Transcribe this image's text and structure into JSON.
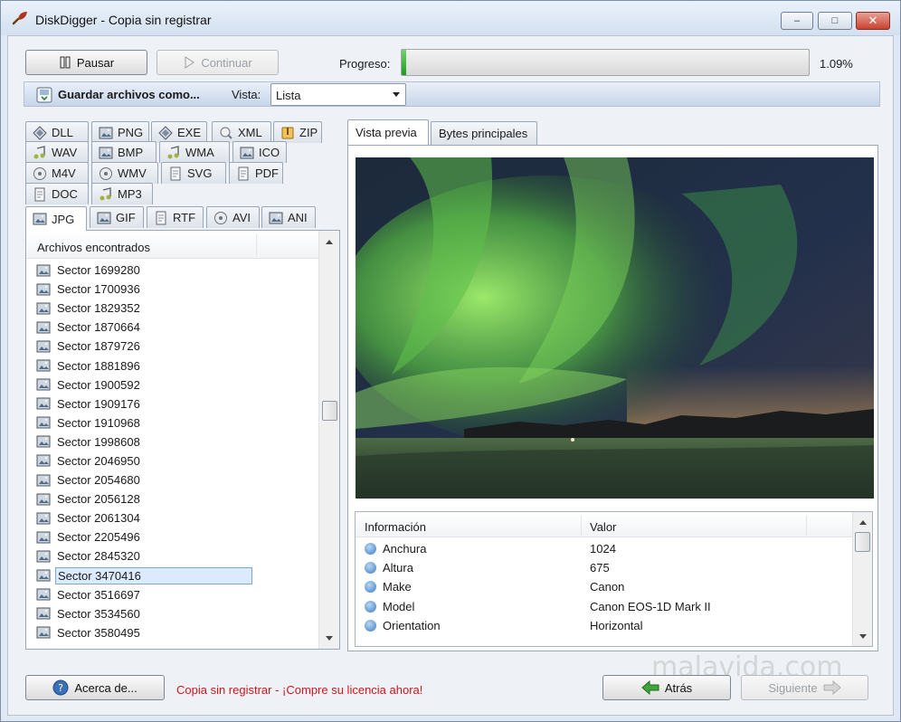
{
  "window": {
    "title": "DiskDigger - Copia sin registrar",
    "minimize_glyph": "–",
    "maximize_glyph": "□",
    "close_glyph": "✕"
  },
  "toolbar": {
    "pause_label": "Pausar",
    "continue_label": "Continuar",
    "progress_label": "Progreso:",
    "progress_percent": "1.09%",
    "progress_fraction": 0.0109
  },
  "save_bar": {
    "save_label": "Guardar archivos como...",
    "view_label": "Vista:",
    "view_value": "Lista"
  },
  "file_type_tabs": [
    {
      "label": "DLL",
      "icon": "dll-icon"
    },
    {
      "label": "PNG",
      "icon": "image-icon"
    },
    {
      "label": "EXE",
      "icon": "exe-icon"
    },
    {
      "label": "XML",
      "icon": "xml-icon"
    },
    {
      "label": "ZIP",
      "icon": "zip-icon"
    },
    {
      "label": "WAV",
      "icon": "audio-icon"
    },
    {
      "label": "BMP",
      "icon": "image-icon"
    },
    {
      "label": "WMA",
      "icon": "audio-icon"
    },
    {
      "label": "ICO",
      "icon": "image-icon"
    },
    {
      "label": "M4V",
      "icon": "video-icon"
    },
    {
      "label": "WMV",
      "icon": "video-icon"
    },
    {
      "label": "SVG",
      "icon": "document-icon"
    },
    {
      "label": "PDF",
      "icon": "document-icon"
    },
    {
      "label": "DOC",
      "icon": "document-icon"
    },
    {
      "label": "MP3",
      "icon": "audio-icon"
    },
    {
      "label": "JPG",
      "icon": "image-icon",
      "active": true
    },
    {
      "label": "GIF",
      "icon": "image-icon"
    },
    {
      "label": "RTF",
      "icon": "document-icon"
    },
    {
      "label": "AVI",
      "icon": "video-icon"
    },
    {
      "label": "ANI",
      "icon": "image-icon"
    }
  ],
  "files": {
    "header": "Archivos encontrados",
    "items": [
      "Sector 1699280",
      "Sector 1700936",
      "Sector 1829352",
      "Sector 1870664",
      "Sector 1879726",
      "Sector 1881896",
      "Sector 1900592",
      "Sector 1909176",
      "Sector 1910968",
      "Sector 1998608",
      "Sector 2046950",
      "Sector 2054680",
      "Sector 2056128",
      "Sector 2061304",
      "Sector 2205496",
      "Sector 2845320",
      "Sector 3470416",
      "Sector 3516697",
      "Sector 3534560",
      "Sector 3580495"
    ],
    "selected_index": 16
  },
  "preview": {
    "tabs": [
      "Vista previa",
      "Bytes principales"
    ],
    "active_tab": 0
  },
  "info": {
    "header_key": "Información",
    "header_value": "Valor",
    "rows": [
      {
        "key": "Anchura",
        "value": "1024"
      },
      {
        "key": "Altura",
        "value": "675"
      },
      {
        "key": "Make",
        "value": "Canon"
      },
      {
        "key": "Model",
        "value": "Canon EOS-1D Mark II"
      },
      {
        "key": "Orientation",
        "value": "Horizontal"
      }
    ]
  },
  "footer": {
    "about_label": "Acerca de...",
    "promo_text": "Copia sin registrar - ¡Compre su licencia ahora!",
    "back_label": "Atrás",
    "next_label": "Siguiente"
  },
  "watermark": "malavida.com",
  "colors": {
    "promo": "#d0141a",
    "progress": "#1e9b1e",
    "accent_blue": "#3a7cc0"
  }
}
